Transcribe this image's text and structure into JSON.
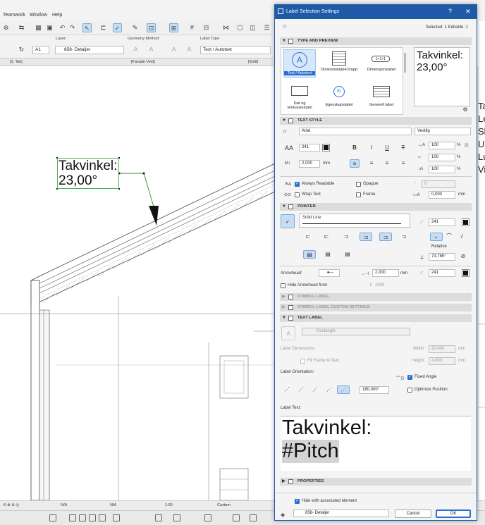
{
  "app": {
    "menu": [
      "Teamwork",
      "Window",
      "Help"
    ],
    "info": {
      "layer_caption": "Layer:",
      "layer_value": "858- Detaljer",
      "geometry_caption": "Geometry Method:",
      "label_type_caption": "Label Type:",
      "label_type_value": "Text / Autotext",
      "anchor_value": "A1"
    },
    "tabs": [
      "[3. Tak]",
      "[Fasade Vest]",
      "[Snitt]"
    ],
    "drawing_label": [
      "Takvinkel:",
      "23,00°"
    ],
    "right_edge_text": [
      "Ta",
      "Le",
      "Sl",
      "Ur",
      "Lu",
      "Vi"
    ],
    "status": {
      "na1": "N/A",
      "na2": "N/A",
      "scale": "1:50",
      "custom": "Custom"
    }
  },
  "dialog": {
    "title": "Label Selection Settings",
    "help": "?",
    "close": "✕",
    "selected": "Selected: 1 Editable: 1",
    "sections": {
      "type": "TYPE AND PREVIEW",
      "text_style": "TEXT STYLE",
      "pointer": "POINTER",
      "symbol": "SYMBOL LABEL",
      "symbol_custom": "SYMBOL LABEL CUSTOM SETTINGS",
      "text_label": "TEXT LABEL",
      "properties": "PROPERTIES"
    },
    "types": [
      {
        "label": "Text / Autotext",
        "selected": true
      },
      {
        "label": "Dimensionlabel trapp"
      },
      {
        "label": "Dimensjonslabel"
      },
      {
        "label": "Dør og vindusstempel"
      },
      {
        "label": "Egenskapslabel"
      },
      {
        "label": "Generell label"
      }
    ],
    "preview": [
      "Takvinkel:",
      "23,00°"
    ],
    "text_style": {
      "font": "Arial",
      "script": "Vestlig",
      "size": "241",
      "height": "2,000",
      "height_unit": "mm",
      "w1": "100",
      "w2": "100",
      "w3": "100",
      "pct": "%",
      "always_readable": "Always Readable",
      "opaque": "Opaque",
      "wrap_text": "Wrap Text",
      "frame": "Frame",
      "angle_val": "0",
      "offset_val": "0,000",
      "offset_unit": "mm"
    },
    "pointer": {
      "line": "Solid Line",
      "pen": "241",
      "relative": "Relative",
      "angle": "73,785°",
      "arrowhead_label": "Arrowhead:",
      "arrow_size": "2,000",
      "arrow_unit": "mm",
      "arrow_pen": "241",
      "hide_arrow": "Hide Arrowhead from",
      "hide_val": "1:",
      "hide_num": "1000"
    },
    "text_label": {
      "shape": "Rectangle",
      "dims_label": "Label Dimensions:",
      "width_label": "Width:",
      "width_val": "20,000",
      "width_unit": "mm",
      "fit_frame": "Fit Frame to Text",
      "height_label": "Height:",
      "height_val": "4,000",
      "height_unit": "mm",
      "orientation": "Label Orientation:",
      "fixed_angle": "Fixed Angle",
      "angle_val": "180,000°",
      "optimize": "Optimize Position",
      "text_label_caption": "Label Text:",
      "text_line1": "Takvinkel:",
      "text_line2": "#Pitch"
    },
    "footer": {
      "hide_assoc": "Hide with associated element",
      "layer": "858- Detaljer",
      "cancel": "Cancel",
      "ok": "OK"
    }
  }
}
